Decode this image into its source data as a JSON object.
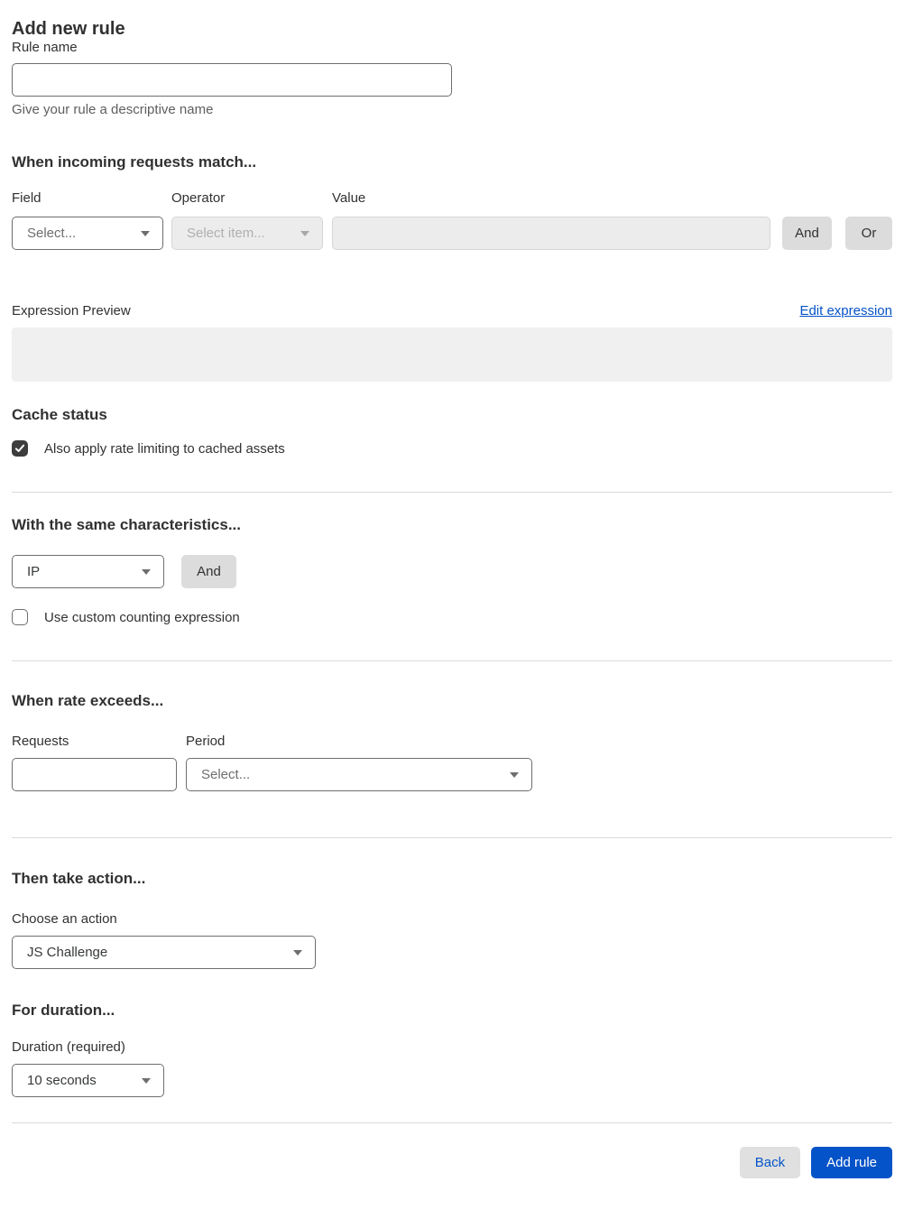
{
  "colors": {
    "accent_blue": "#0553c8",
    "heading_text": "#313131",
    "muted_text": "#5e5e5e",
    "divider": "#d9d9d9",
    "disabled_bg": "#ececec",
    "preview_bg": "#f0f0f0",
    "gray_button_bg": "#dcdcdc",
    "checkbox_checked_bg": "#3d3d3d"
  },
  "page": {
    "title": "Add new rule"
  },
  "rule_name": {
    "label": "Rule name",
    "value": "",
    "helper": "Give your rule a descriptive name"
  },
  "match": {
    "heading": "When incoming requests match...",
    "field_label": "Field",
    "field_value": "Select...",
    "operator_label": "Operator",
    "operator_value": "Select item...",
    "operator_disabled": true,
    "value_label": "Value",
    "value_value": "",
    "value_disabled": true,
    "and_button": "And",
    "or_button": "Or"
  },
  "expression": {
    "label": "Expression Preview",
    "edit_link": "Edit expression",
    "preview_text": ""
  },
  "cache_status": {
    "heading": "Cache status",
    "checkbox_label": "Also apply rate limiting to cached assets",
    "checkbox_checked": true
  },
  "characteristics": {
    "heading": "With the same characteristics...",
    "select_value": "IP",
    "and_button": "And",
    "checkbox_label": "Use custom counting expression",
    "checkbox_checked": false
  },
  "rate": {
    "heading": "When rate exceeds...",
    "requests_label": "Requests",
    "requests_value": "",
    "period_label": "Period",
    "period_value": "Select..."
  },
  "action": {
    "heading": "Then take action...",
    "label": "Choose an action",
    "select_value": "JS Challenge"
  },
  "duration": {
    "heading": "For duration...",
    "label": "Duration (required)",
    "select_value": "10 seconds"
  },
  "footer": {
    "back_button": "Back",
    "add_rule_button": "Add rule"
  }
}
